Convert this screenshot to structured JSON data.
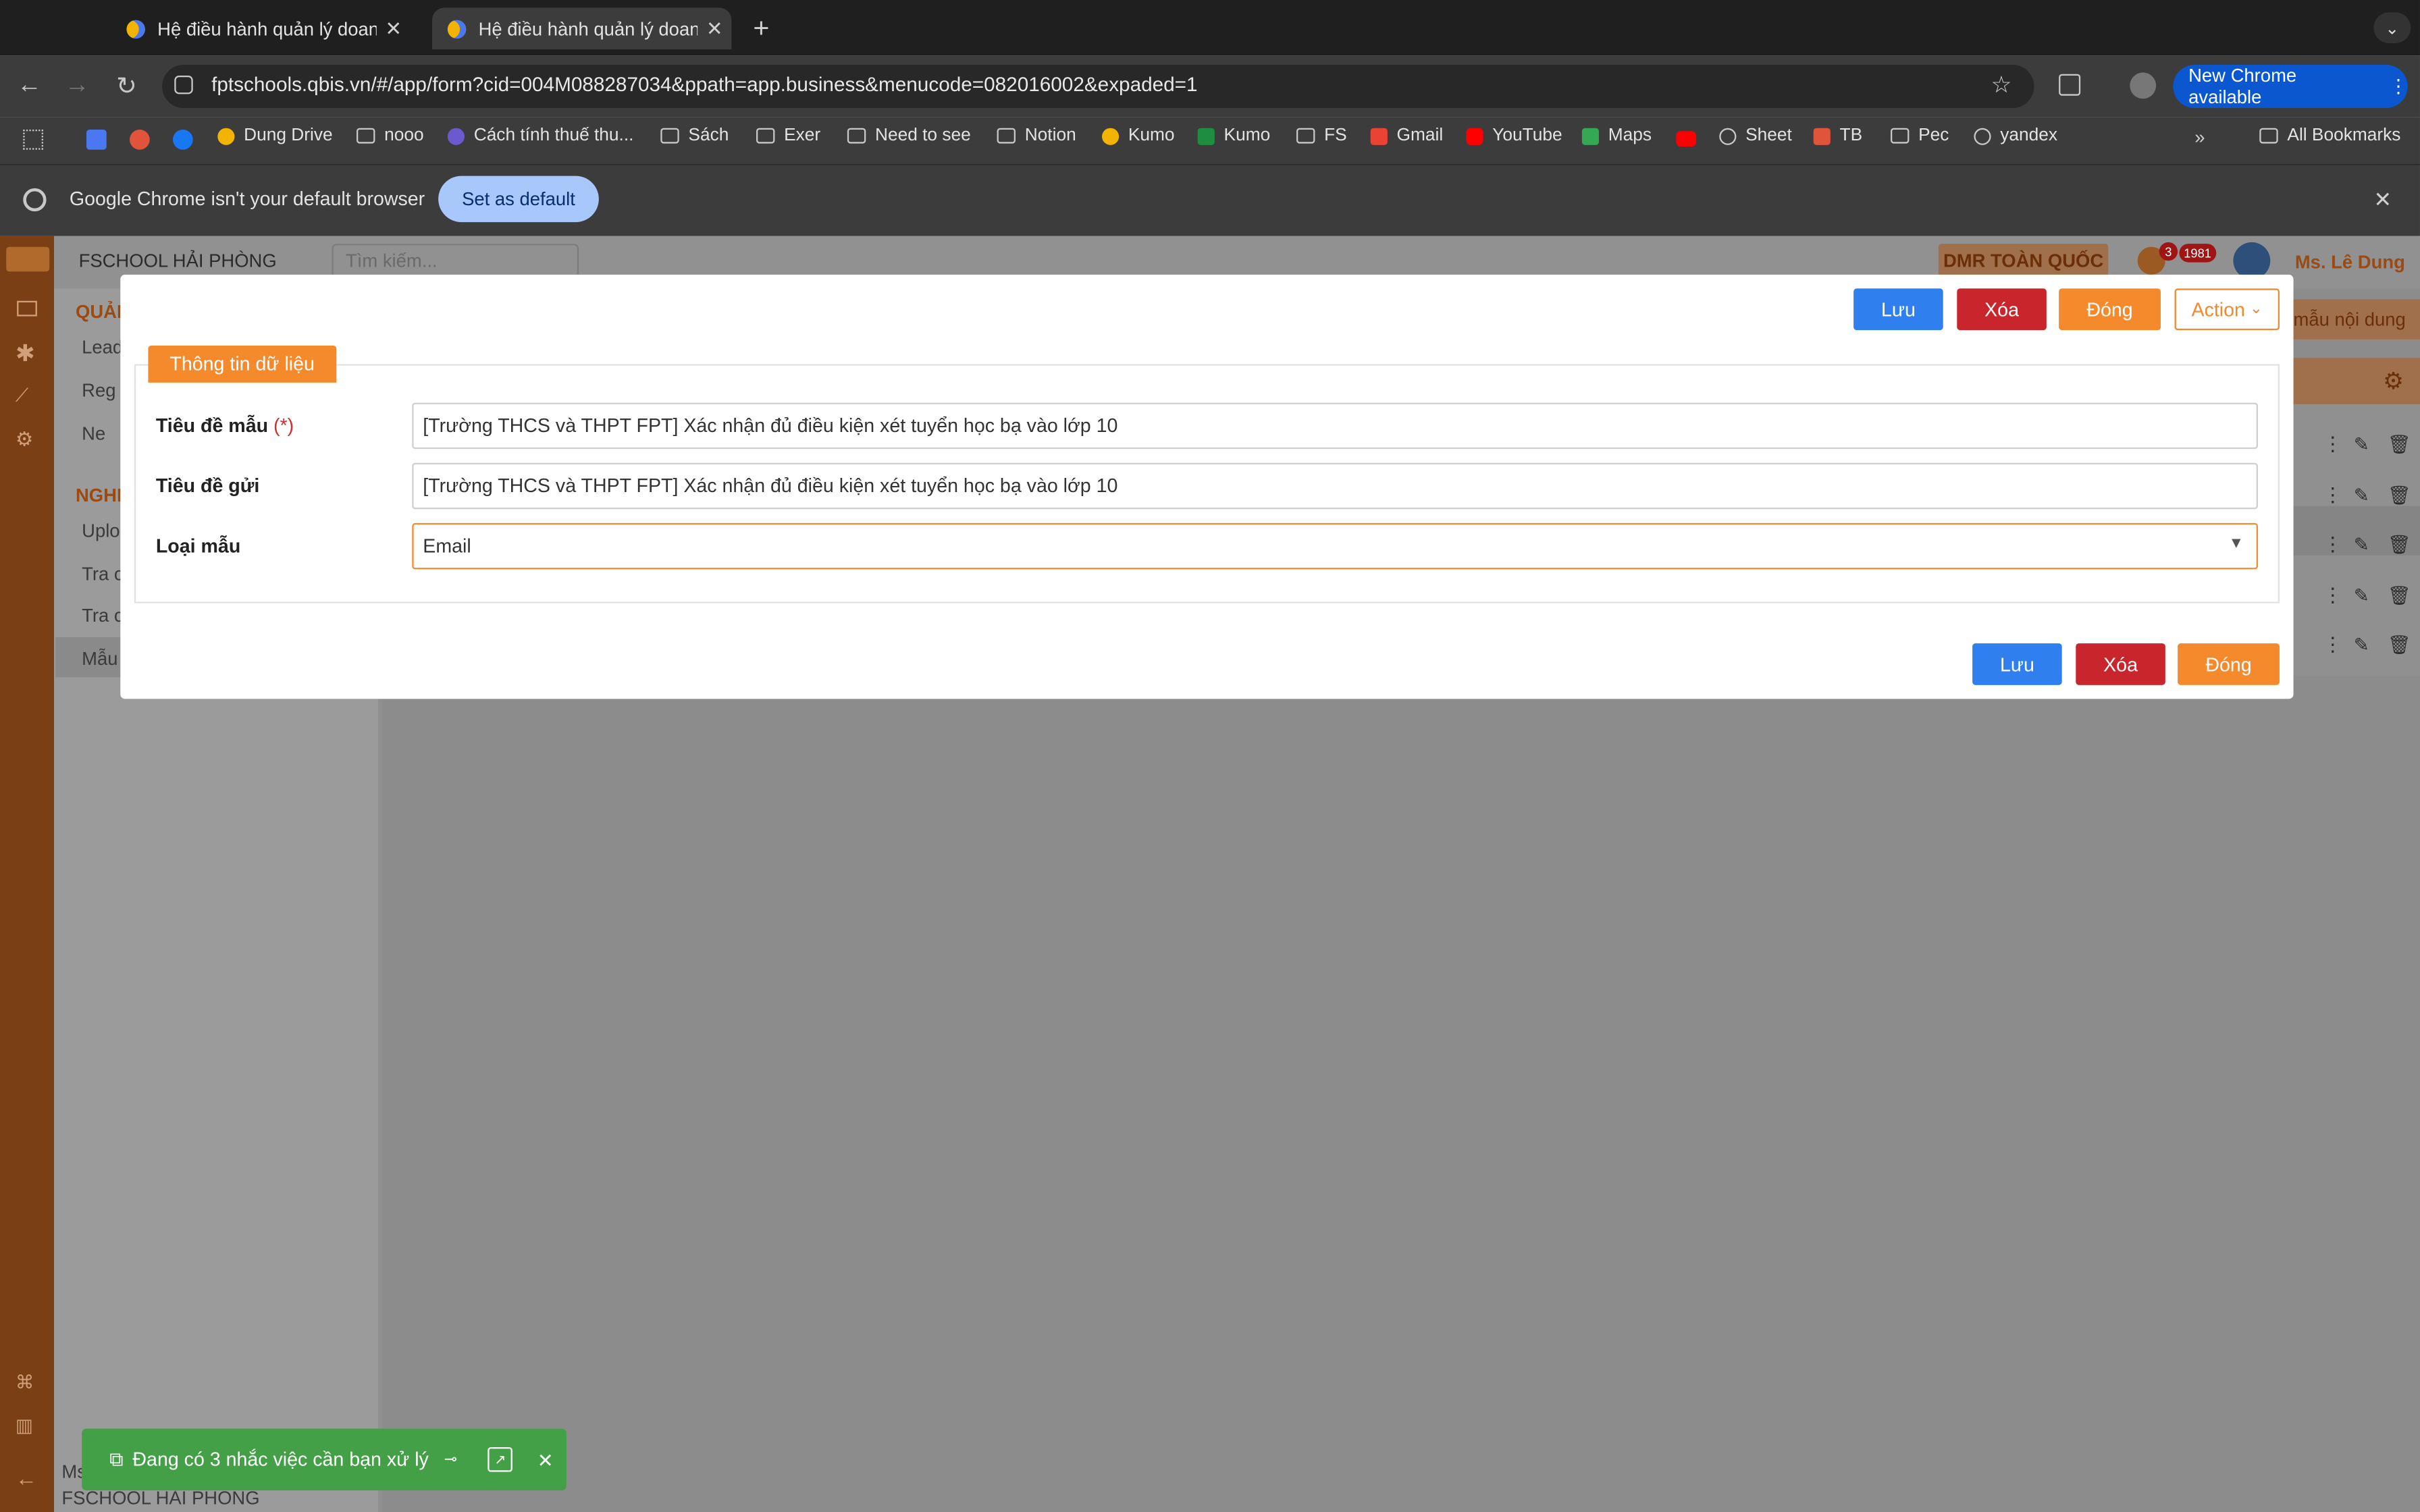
{
  "browser": {
    "tabs": [
      {
        "title": "Hệ điều hành quản lý doanh n"
      },
      {
        "title": "Hệ điều hành quản lý doanh n"
      }
    ],
    "url": "fptschools.qbis.vn/#/app/form?cid=004M088287034&ppath=app.business&menucode=082016002&expaded=1",
    "new_chrome": "New Chrome available",
    "bookmarks": [
      "Dung Drive",
      "nooo",
      "Cách tính thuế thu...",
      "Sách",
      "Exer",
      "Need to see",
      "Notion",
      "Kumo",
      "Kumo",
      "FS",
      "Gmail",
      "YouTube",
      "Maps",
      "Sheet",
      "TB",
      "Pec",
      "yandex"
    ],
    "all_bookmarks": "All Bookmarks",
    "infobar_text": "Google Chrome isn't your default browser",
    "set_default": "Set as default"
  },
  "app": {
    "school": "FSCHOOL HẢI PHÒNG",
    "search_placeholder": "Tìm kiếm...",
    "dmr": "DMR TOÀN QUỐC",
    "badge1": "3",
    "badge2": "1981",
    "user": "Ms. Lê Dung",
    "menu_head1": "QUẢN",
    "menu_items1": [
      "Lead",
      "Reg",
      "Ne"
    ],
    "menu_head2": "NGHI",
    "menu_items2": [
      "Uplo",
      "Tra c",
      "Tra c",
      "Mẫu"
    ],
    "right_text": "mẫu nội dung",
    "footer_user": "Ms",
    "footer_school": "FSCHOOL HẢI PHÒNG"
  },
  "modal": {
    "save": "Lưu",
    "delete": "Xóa",
    "close": "Đóng",
    "action": "Action",
    "legend": "Thông tin dữ liệu",
    "fields": {
      "template_title_label": "Tiêu đề mẫu",
      "required_mark": "(*)",
      "template_title_value": "[Trường THCS và THPT FPT] Xác nhận đủ điều kiện xét tuyển học bạ vào lớp 10",
      "send_title_label": "Tiêu đề gửi",
      "send_title_value": "[Trường THCS và THPT FPT] Xác nhận đủ điều kiện xét tuyển học bạ vào lớp 10",
      "type_label": "Loại mẫu",
      "type_value": "Email"
    }
  },
  "toast": {
    "text": "Đang có 3 nhắc việc cần bạn xử lý"
  }
}
